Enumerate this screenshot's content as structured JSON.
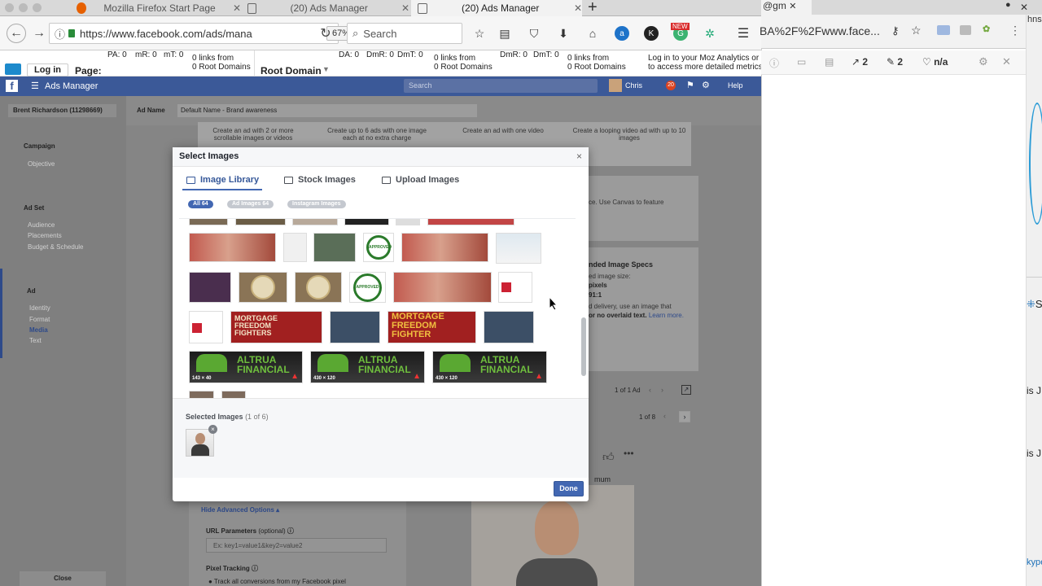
{
  "browser": {
    "tabs": [
      {
        "title": "Mozilla Firefox Start Page"
      },
      {
        "title": "(20) Ads Manager"
      },
      {
        "title": "(20) Ads Manager"
      }
    ],
    "url": "https://www.facebook.com/ads/mana",
    "zoom": "67%",
    "search_placeholder": "Search",
    "new_badge": "NEW"
  },
  "moz": {
    "login": "Log in",
    "page_label": "Page:",
    "pa": "PA: 0",
    "mr": "mR: 0",
    "mt": "mT: 0",
    "links1": "0 links from",
    "links1b": "0 Root Domains",
    "root_domain": "Root Domain",
    "da": "DA: 0",
    "dmr": "DmR: 0",
    "dmt": "DmT: 0",
    "links2": "0 links from",
    "links2b": "0 Root Domains",
    "dmr2": "DmR: 0",
    "dmt2": "DmT: 0",
    "links3": "0 links from",
    "links3b": "0 Root Domains",
    "login_note": "Log in to your Moz Analytics or PR",
    "login_note2": "to access more detailed metrics."
  },
  "fb": {
    "app_title": "Ads Manager",
    "search_placeholder": "Search",
    "user": "Chris",
    "notif": "20",
    "help": "Help",
    "account": "Brent Richardson (11298669)",
    "ad_name_label": "Ad Name",
    "ad_name_value": "Default Name - Brand awareness",
    "left": {
      "campaign": "Campaign",
      "objective": "Objective",
      "adset": "Ad Set",
      "audience": "Audience",
      "placements": "Placements",
      "budget": "Budget & Schedule",
      "ad": "Ad",
      "identity": "Identity",
      "format": "Format",
      "media": "Media",
      "text": "Text",
      "close": "Close"
    },
    "formats": [
      "Create an ad with 2 or more scrollable images or videos",
      "Create up to 6 ads with one image each at no extra charge",
      "Create an ad with one video",
      "Create a looping video ad with up to 10 images"
    ],
    "canvas_note": "ce. Use Canvas to feature",
    "specs_title": "nded Image Specs",
    "specs_1": "ed image size:",
    "specs_2": "pixels",
    "specs_3": "91:1",
    "specs_4": "d delivery, use an image that",
    "specs_5": "or no overlaid text.",
    "learn_more": "Learn more.",
    "pager1": "1 of 1 Ad",
    "pager2": "1 of 8",
    "hide_adv": "Hide Advanced Options",
    "url_params": "URL Parameters",
    "optional": "(optional)",
    "url_placeholder": "Ex: key1=value1&key2=value2",
    "pixel_tracking": "Pixel Tracking",
    "track_all": "Track all conversions from my Facebook pixel",
    "mum": "mum"
  },
  "right": {
    "tab_text": "@gm",
    "url_text": "BA%2F%2Fwww.face...",
    "count1": "2",
    "count2": "2",
    "na": "n/a",
    "side1": "S",
    "side2": "is J",
    "side3": "is J",
    "side4": "hns",
    "side5": "kype"
  },
  "modal": {
    "title": "Select Images",
    "tabs": [
      "Image Library",
      "Stock Images",
      "Upload Images"
    ],
    "filters": [
      "All  64",
      "Ad Images  64",
      "Instagram Images"
    ],
    "dims": [
      "143 × 40",
      "430 × 120",
      "430 × 120"
    ],
    "altrua": "ALTRUA",
    "financial": "FINANCIAL",
    "mortgage": "MORTGAGE",
    "freedom": "FREEDOM",
    "fighters": "FIGHTERS",
    "fighter": "FIGHTER",
    "approved": "APPROVED",
    "selected_label": "Selected Images",
    "selected_count": "(1 of 6)",
    "done": "Done"
  }
}
